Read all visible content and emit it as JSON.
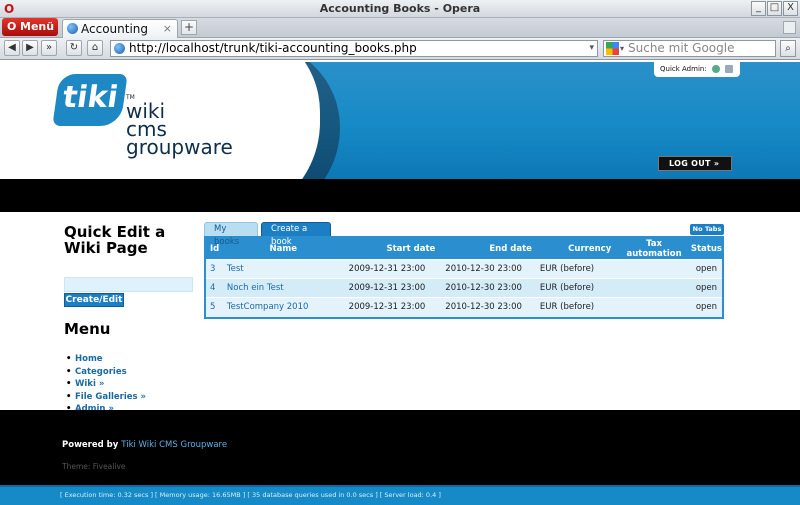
{
  "window": {
    "title": "Accounting Books - Opera",
    "menu_label": "Menü",
    "tab_label": "Accounting Bo...",
    "tab_close": "×",
    "new_tab": "+",
    "url": "http://localhost/trunk/tiki-accounting_books.php",
    "search_placeholder": "Suche mit Google",
    "window_buttons": [
      "_",
      "□",
      "X"
    ]
  },
  "header": {
    "logo_text": "tiki",
    "logo_tm": "TM",
    "wordmark": [
      "wiki",
      "cms",
      "groupware"
    ],
    "quick_admin_label": "Quick Admin:",
    "logout_label": "LOG OUT »"
  },
  "sidebar": {
    "quick_edit_title": "Quick Edit a Wiki Page",
    "create_button": "Create/Edit",
    "menu_title": "Menu",
    "menu_items": [
      "Home",
      "Categories",
      "Wiki »",
      "File Galleries »",
      "Admin »"
    ]
  },
  "books": {
    "tabs": [
      "My books",
      "Create a book"
    ],
    "no_tabs_label": "No Tabs",
    "columns": [
      "Id",
      "Name",
      "Start date",
      "End date",
      "Currency",
      "Tax automation",
      "Status"
    ],
    "rows": [
      {
        "id": "3",
        "name": "Test",
        "start": "2009-12-31 23:00",
        "end": "2010-12-30 23:00",
        "currency": "EUR (before)",
        "tax": "",
        "status": "open"
      },
      {
        "id": "4",
        "name": "Noch ein Test",
        "start": "2009-12-31 23:00",
        "end": "2010-12-30 23:00",
        "currency": "EUR (before)",
        "tax": "",
        "status": "open"
      },
      {
        "id": "5",
        "name": "TestCompany 2010",
        "start": "2009-12-31 23:00",
        "end": "2010-12-30 23:00",
        "currency": "EUR (before)",
        "tax": "",
        "status": "open"
      }
    ]
  },
  "footer": {
    "powered_by": "Powered by",
    "powered_link": "Tiki Wiki CMS Groupware",
    "theme": "Theme: Fivealive",
    "stats": "[ Execution time: 0.32 secs ]   [ Memory usage: 16.65MB ]   [ 35 database queries used in 0.0 secs ]   [ Server load: 0.4 ]"
  },
  "colors": {
    "accent": "#1d7fc3",
    "header_blue": "#168ac6",
    "opera_red": "#c81010"
  }
}
